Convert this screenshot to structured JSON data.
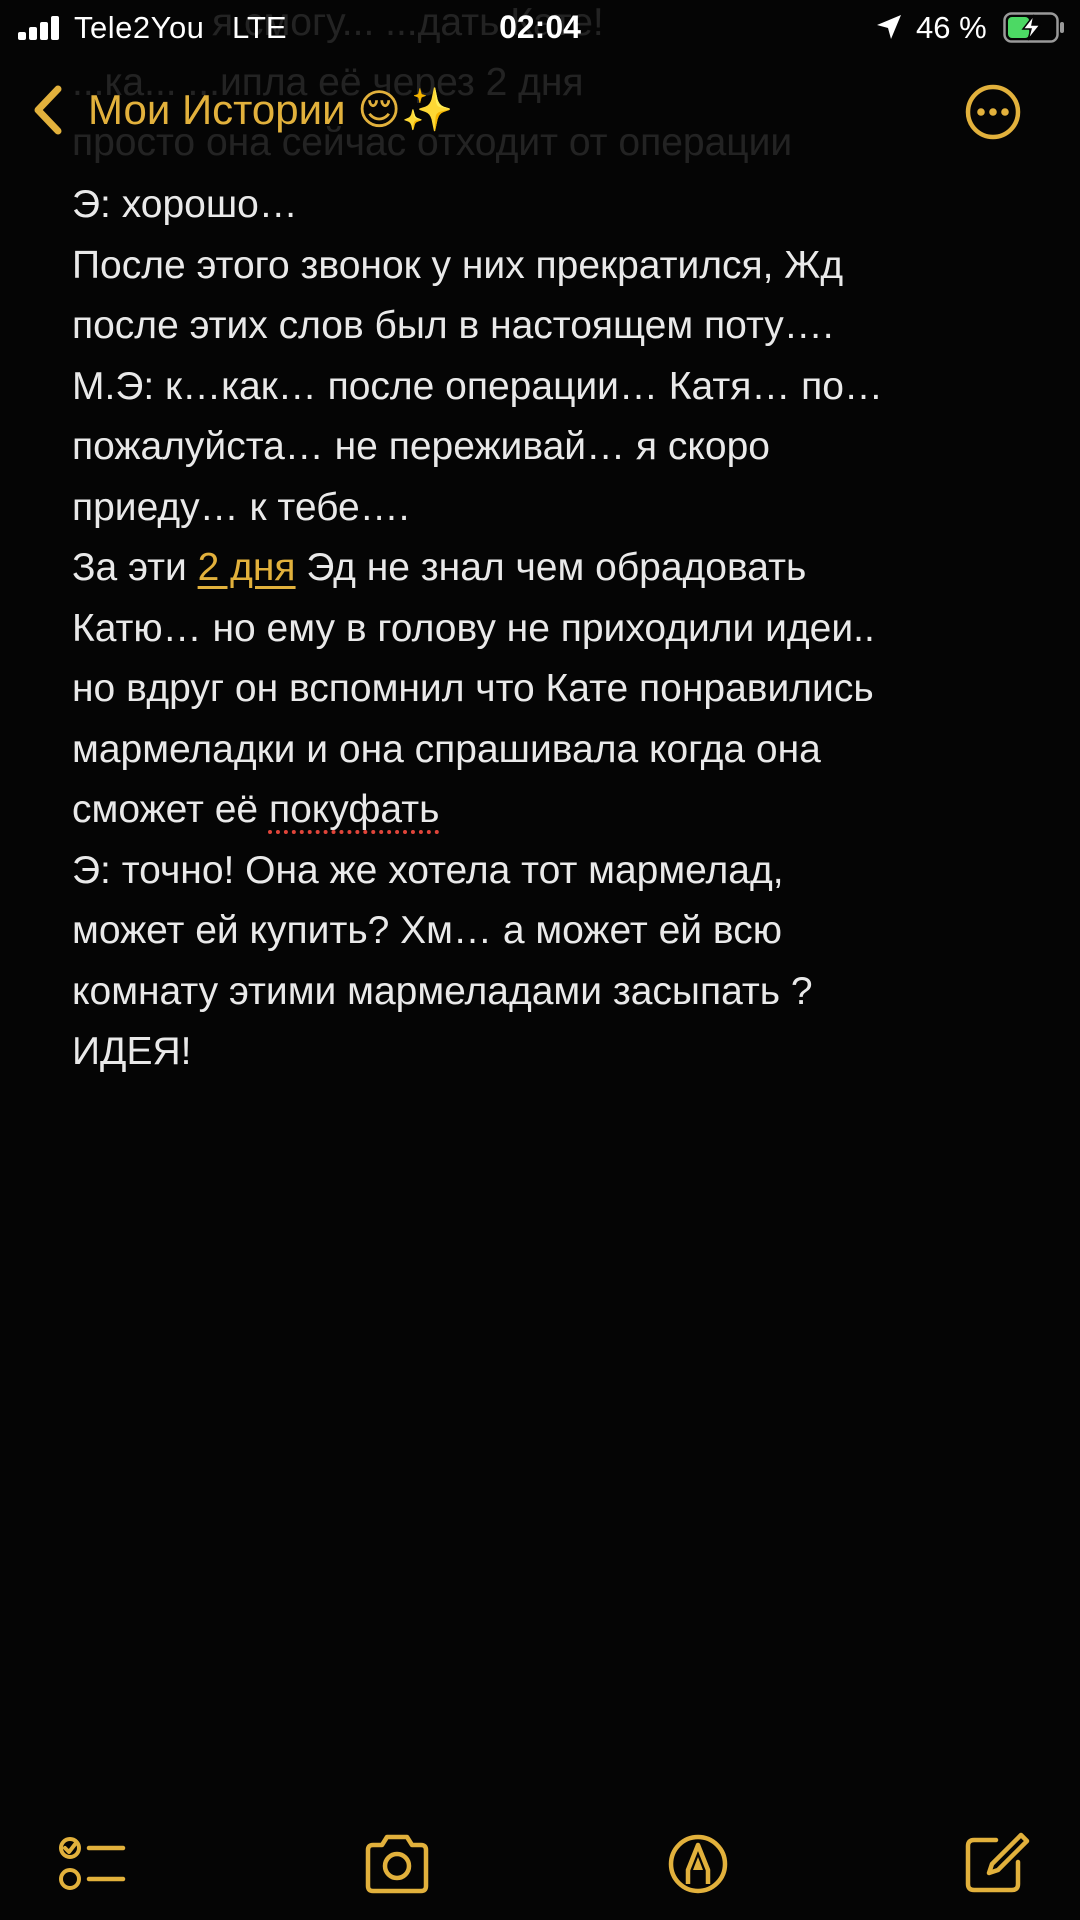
{
  "status_bar": {
    "carrier": "Tele2You",
    "network": "LTE",
    "time": "02:04",
    "battery_percent": "46 %",
    "battery_level": 0.46,
    "icons": [
      "signal-icon",
      "location-arrow-icon",
      "battery-charging-icon"
    ]
  },
  "nav": {
    "back_label": "Мои Истории 😌✨",
    "icons": [
      "chevron-left-icon",
      "more-options-icon"
    ]
  },
  "ghost_lines": [
    "я смогу... ...дать Кате!",
    "...ка... ...ипла её через 2 дня",
    "просто она сейчас отходит от операции"
  ],
  "note": {
    "lines": [
      {
        "parts": [
          {
            "text": "Э: хорошо…"
          }
        ]
      },
      {
        "parts": [
          {
            "text": "После этого звонок у них прекратился, Жд"
          }
        ]
      },
      {
        "parts": [
          {
            "text": "после этих слов был в настоящем поту…."
          }
        ]
      },
      {
        "parts": [
          {
            "text": "М.Э: к…как… после операции… Катя… по…"
          }
        ]
      },
      {
        "parts": [
          {
            "text": "пожалуйста… не переживай… я скоро"
          }
        ]
      },
      {
        "parts": [
          {
            "text": "приеду… к тебе…."
          }
        ]
      },
      {
        "parts": [
          {
            "text": "За эти "
          },
          {
            "text": "2 дня",
            "style": "link"
          },
          {
            "text": " Эд не знал чем обрадовать"
          }
        ]
      },
      {
        "parts": [
          {
            "text": "Катю… но ему в голову не приходили идеи.."
          }
        ]
      },
      {
        "parts": [
          {
            "text": "но вдруг он вспомнил что Кате понравились"
          }
        ]
      },
      {
        "parts": [
          {
            "text": "мармеладки и она спрашивала когда она"
          }
        ]
      },
      {
        "parts": [
          {
            "text": "сможет её "
          },
          {
            "text": "покуфать",
            "style": "misspelled"
          }
        ]
      },
      {
        "parts": [
          {
            "text": "Э: точно! Она же хотела тот мармелад,"
          }
        ]
      },
      {
        "parts": [
          {
            "text": "может ей купить? Хм… а может ей всю"
          }
        ]
      },
      {
        "parts": [
          {
            "text": "комнату этими мармеладами засыпать ?"
          }
        ]
      },
      {
        "parts": [
          {
            "text": "ИДЕЯ!"
          }
        ]
      }
    ]
  },
  "toolbar": {
    "icons": [
      "checklist-icon",
      "camera-icon",
      "markup-pen-icon",
      "compose-icon"
    ]
  },
  "colors": {
    "accent": "#e2b13c",
    "background": "#050505",
    "text": "#e9e9e9",
    "spellcheck": "#e0453a",
    "battery_charging": "#4cd964"
  }
}
